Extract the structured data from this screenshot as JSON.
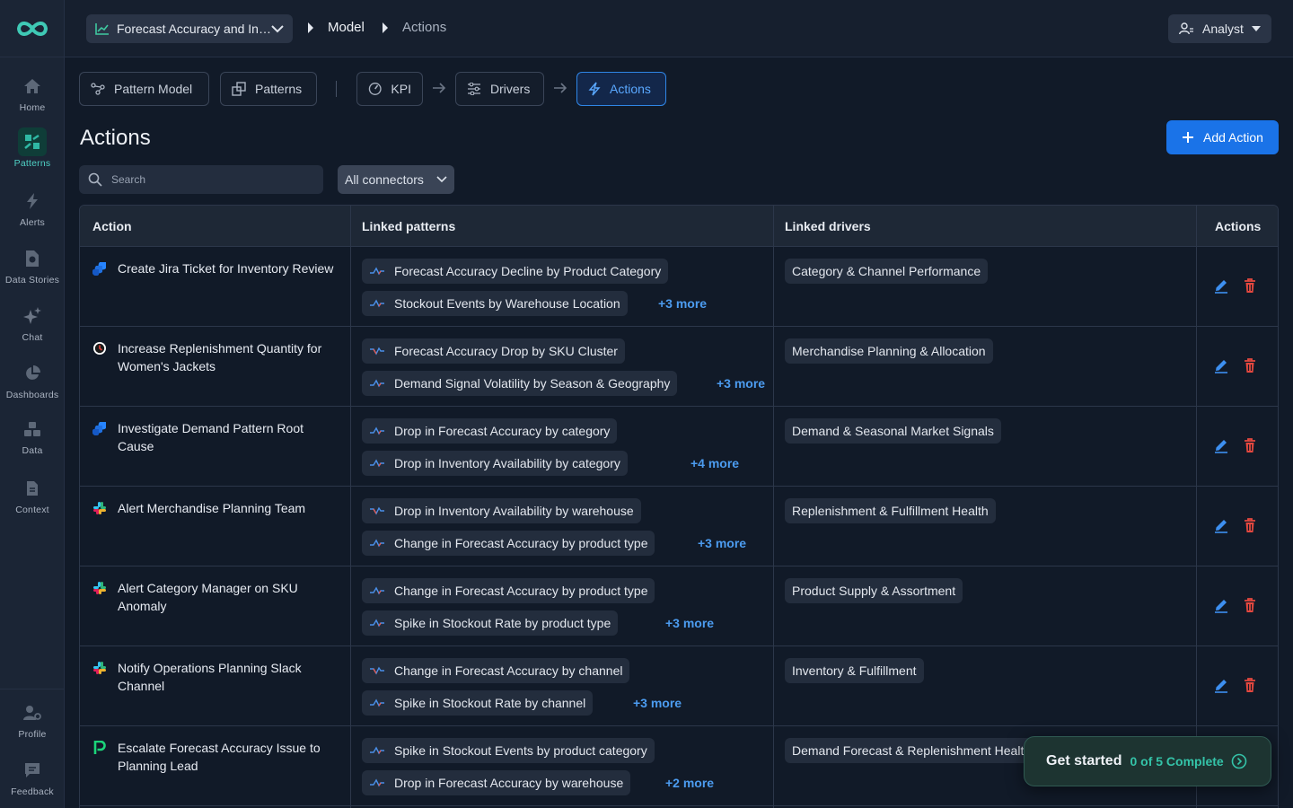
{
  "nav": {
    "items": [
      {
        "label": "Home",
        "icon": "home-icon"
      },
      {
        "label": "Patterns",
        "icon": "patterns-icon"
      },
      {
        "label": "Alerts",
        "icon": "bolt-icon"
      },
      {
        "label": "Data Stories",
        "icon": "document-icon"
      },
      {
        "label": "Chat",
        "icon": "sparkles-icon"
      },
      {
        "label": "Dashboards",
        "icon": "pie-chart-icon"
      },
      {
        "label": "Data",
        "icon": "cubes-icon"
      },
      {
        "label": "Context",
        "icon": "file-icon"
      }
    ],
    "bottom": [
      {
        "label": "Profile",
        "icon": "user-gear-icon"
      },
      {
        "label": "Feedback",
        "icon": "chat-bubble-icon"
      }
    ]
  },
  "topbar": {
    "project": "Forecast Accuracy and Inventory Performance",
    "breadcrumb": [
      "Model",
      "Actions"
    ],
    "role": "Analyst"
  },
  "tabs": {
    "pattern_model": "Pattern Model",
    "patterns": "Patterns",
    "kpi": "KPI",
    "drivers": "Drivers",
    "actions": "Actions"
  },
  "page": {
    "title": "Actions",
    "add_button": "Add Action",
    "search_placeholder": "Search",
    "connector_filter": "All connectors"
  },
  "table": {
    "headers": {
      "action": "Action",
      "patterns": "Linked patterns",
      "drivers": "Linked drivers",
      "actions": "Actions"
    },
    "rows": [
      {
        "action": "Create Jira Ticket for Inventory Review",
        "connector": "jira",
        "patterns": [
          "Forecast Accuracy Decline by Product Category",
          "Stockout Events by Warehouse Location"
        ],
        "more": "+3 more",
        "driver": "Category & Channel Performance"
      },
      {
        "action": "Increase Replenishment Quantity for Women's Jackets",
        "connector": "clock",
        "patterns": [
          "Forecast Accuracy Drop by SKU Cluster",
          "Demand Signal Volatility by Season & Geography"
        ],
        "more": "+3 more",
        "driver": "Merchandise Planning & Allocation"
      },
      {
        "action": "Investigate Demand Pattern Root Cause",
        "connector": "jira",
        "patterns": [
          "Drop in Forecast Accuracy by category",
          "Drop in Inventory Availability by category"
        ],
        "more": "+4 more",
        "driver": "Demand & Seasonal Market Signals"
      },
      {
        "action": "Alert Merchandise Planning Team",
        "connector": "slack",
        "patterns": [
          "Drop in Inventory Availability by warehouse",
          "Change in Forecast Accuracy by product type"
        ],
        "more": "+3 more",
        "driver": "Replenishment & Fulfillment Health"
      },
      {
        "action": "Alert Category Manager on SKU Anomaly",
        "connector": "slack",
        "patterns": [
          "Change in Forecast Accuracy by product type",
          "Spike in Stockout Rate by product type"
        ],
        "more": "+3 more",
        "driver": "Product Supply & Assortment"
      },
      {
        "action": "Notify Operations Planning Slack Channel",
        "connector": "slack",
        "patterns": [
          "Change in Forecast Accuracy by channel",
          "Spike in Stockout Rate by channel"
        ],
        "more": "+3 more",
        "driver": "Inventory & Fulfillment"
      },
      {
        "action": "Escalate Forecast Accuracy Issue to Planning Lead",
        "connector": "pagerduty",
        "patterns": [
          "Spike in Stockout Events by product category",
          "Drop in Forecast Accuracy by warehouse"
        ],
        "more": "+2 more",
        "driver": "Demand Forecast & Replenishment Health"
      }
    ]
  },
  "get_started": {
    "title": "Get started",
    "progress": "0 of 5 Complete"
  },
  "colors": {
    "accent": "#1a73e8",
    "link": "#4c9cf0",
    "delete": "#e5483f",
    "active_nav": "#4fd1c5",
    "progress": "#34c3a8"
  }
}
